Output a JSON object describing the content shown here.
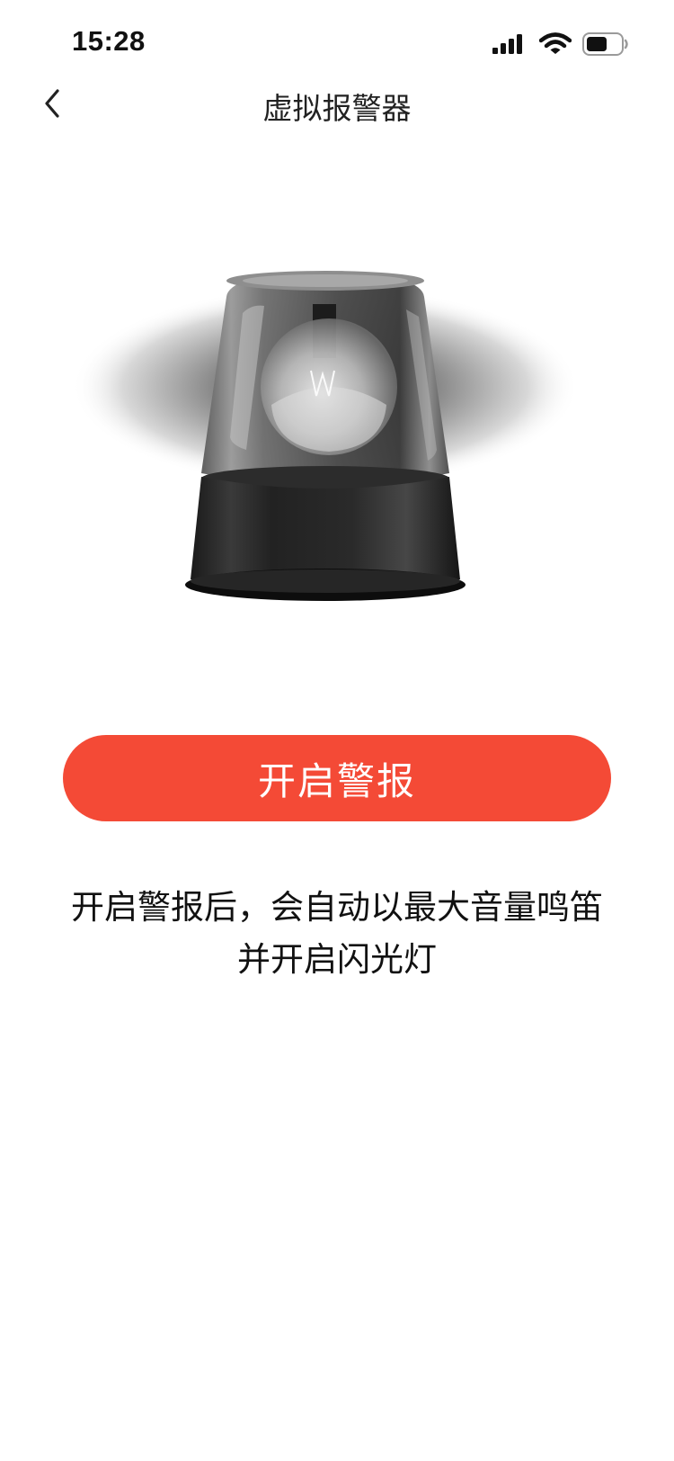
{
  "status_bar": {
    "time": "15:28",
    "icons": [
      "cellular-signal-icon",
      "wifi-icon",
      "battery-icon"
    ]
  },
  "nav": {
    "back_icon": "chevron-left-icon",
    "title": "虚拟报警器"
  },
  "illustration": {
    "name": "siren-icon"
  },
  "primary_button": {
    "label": "开启警报",
    "color": "#f44a36"
  },
  "description": {
    "line1": "开启警报后，会自动以最大音量鸣笛",
    "line2": "并开启闪光灯"
  },
  "colors": {
    "background": "#ffffff",
    "accent": "#f44a36",
    "text": "#111111"
  }
}
